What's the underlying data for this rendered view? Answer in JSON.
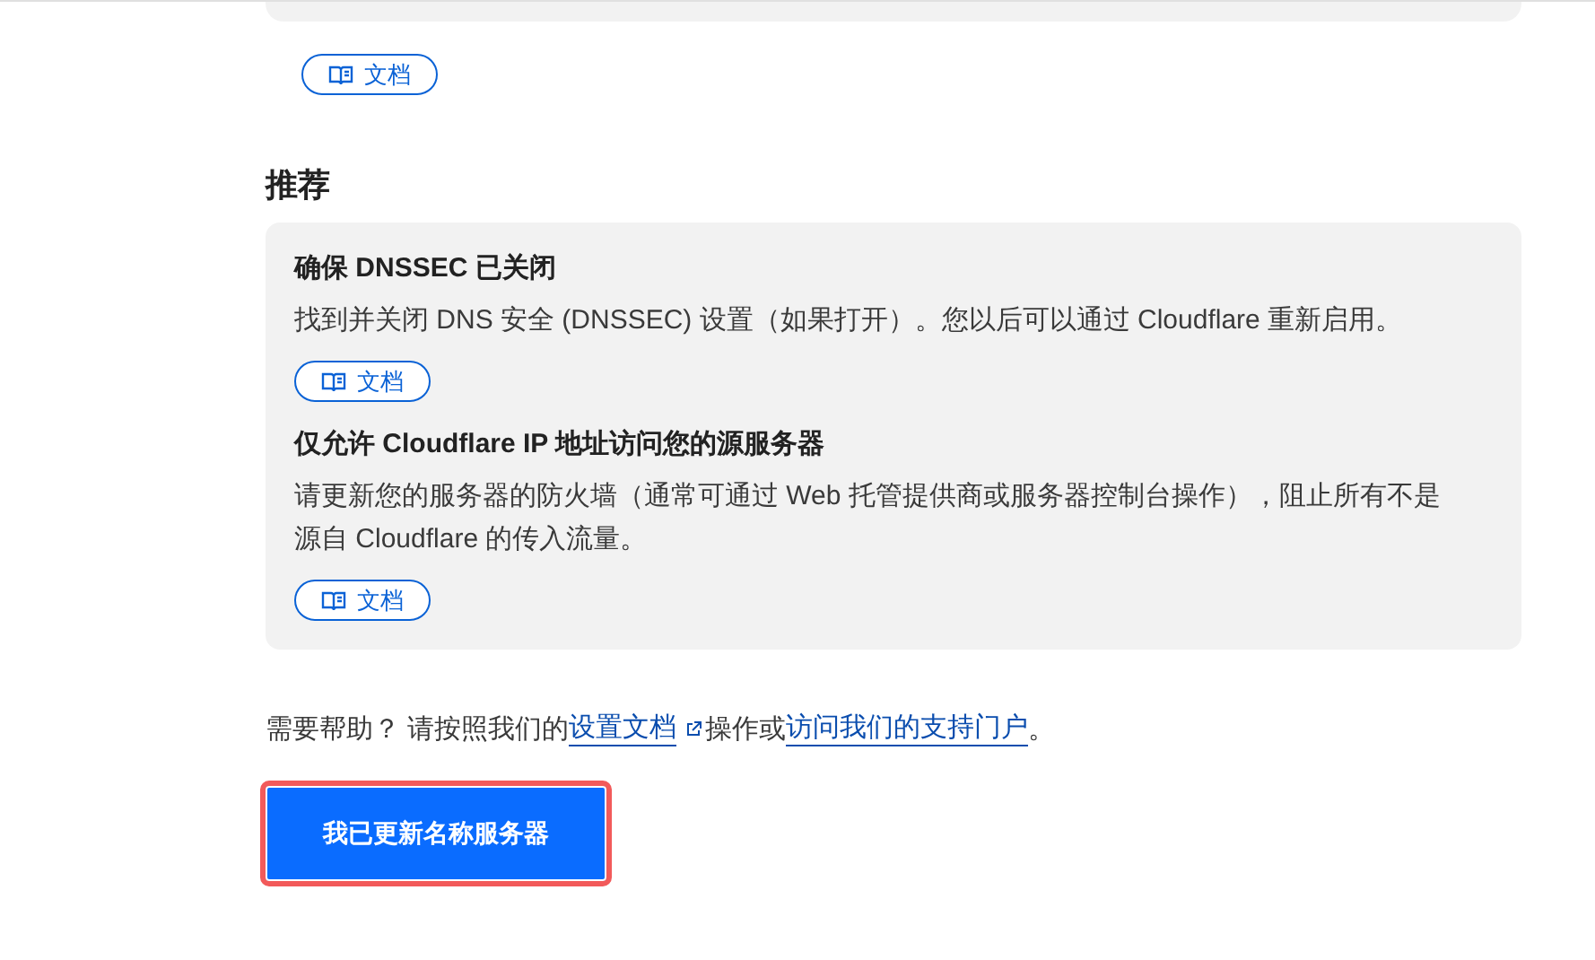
{
  "previous_section": {
    "docs_button": "文档"
  },
  "recommendations": {
    "heading": "推荐",
    "items": [
      {
        "title": "确保 DNSSEC 已关闭",
        "lines": [
          "找到并关闭 DNS 安全 (DNSSEC) 设置（如果打开）。您以后可以通过 Cloudflare 重新启用。"
        ],
        "docs_button": "文档"
      },
      {
        "title": "仅允许 Cloudflare IP 地址访问您的源服务器",
        "lines": [
          "请更新您的服务器的防火墙（通常可通过 Web 托管提供商或服务器控制台操作），阻止所有不是",
          "源自 Cloudflare 的传入流量。"
        ],
        "docs_button": "文档"
      }
    ]
  },
  "help": {
    "lead": "需要帮助？ 请按照我们的",
    "docs_link": "设置文档",
    "middle": "操作或",
    "support_link": "访问我们的支持门户",
    "end": "。"
  },
  "confirm_button": {
    "label": "我已更新名称服务器",
    "highlighted": true
  }
}
